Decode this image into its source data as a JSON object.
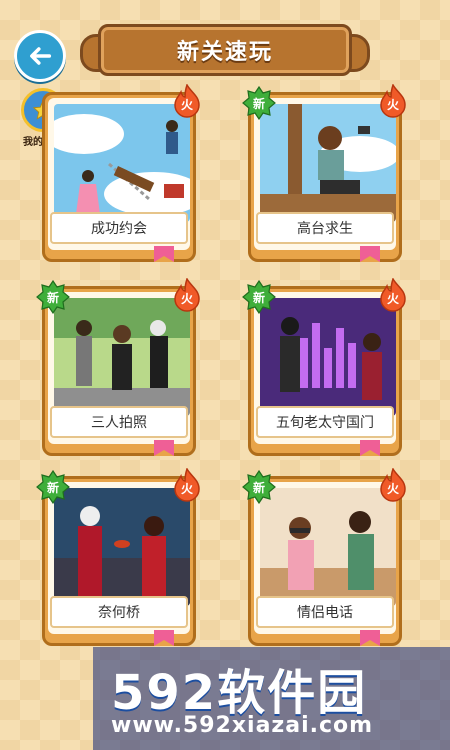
{
  "header": {
    "title": "新关速玩",
    "back_icon": "arrow-left-icon"
  },
  "achievement": {
    "label": "我的成就",
    "icon": "star-badge-icon"
  },
  "badges": {
    "hot": "火",
    "new": "新"
  },
  "levels": [
    {
      "name": "成功约会",
      "is_new": false,
      "is_hot": true
    },
    {
      "name": "高台求生",
      "is_new": true,
      "is_hot": true
    },
    {
      "name": "三人拍照",
      "is_new": true,
      "is_hot": true
    },
    {
      "name": "五旬老太守国门",
      "is_new": true,
      "is_hot": true
    },
    {
      "name": "奈何桥",
      "is_new": true,
      "is_hot": true
    },
    {
      "name": "情侣电话",
      "is_new": true,
      "is_hot": true
    }
  ],
  "watermark": {
    "brand": "592软件园",
    "url": "www.592xiazai.com"
  },
  "colors": {
    "card": "#e8a449",
    "hot": "#f05a28",
    "new": "#3fae3a",
    "back": "#2f9fd0"
  }
}
